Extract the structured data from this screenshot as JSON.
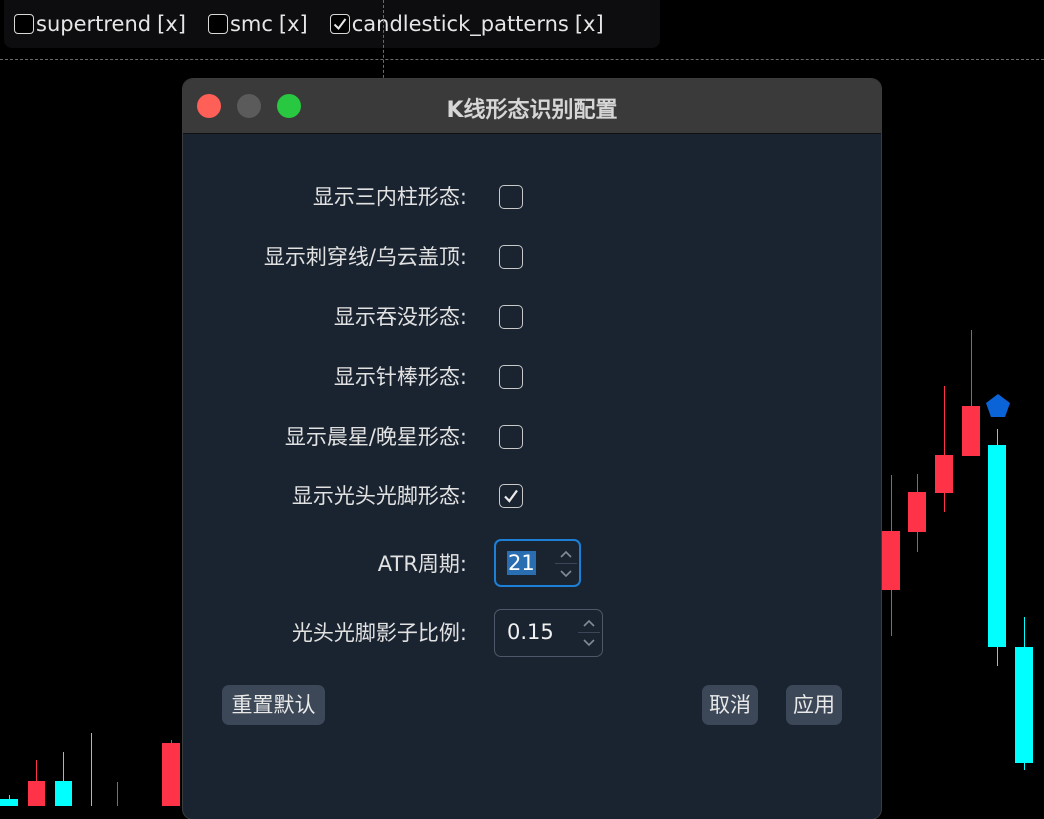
{
  "indicators": [
    {
      "label": "supertrend",
      "remove": "[x]",
      "checked": false
    },
    {
      "label": "smc",
      "remove": "[x]",
      "checked": false
    },
    {
      "label": "candlestick_patterns",
      "remove": "[x]",
      "checked": true
    }
  ],
  "dialog": {
    "title": "K线形态识别配置",
    "options": [
      {
        "label": "显示三内柱形态:",
        "checked": false
      },
      {
        "label": "显示刺穿线/乌云盖顶:",
        "checked": false
      },
      {
        "label": "显示吞没形态:",
        "checked": false
      },
      {
        "label": "显示针棒形态:",
        "checked": false
      },
      {
        "label": "显示晨星/晚星形态:",
        "checked": false
      },
      {
        "label": "显示光头光脚形态:",
        "checked": true
      }
    ],
    "atr_label": "ATR周期:",
    "atr_value": "21",
    "ratio_label": "光头光脚影子比例:",
    "ratio_value": "0.15",
    "reset_button": "重置默认",
    "cancel_button": "取消",
    "apply_button": "应用"
  },
  "colors": {
    "bull": "#00ffff",
    "bear": "#ff3348",
    "marker": "#0a64d8"
  }
}
